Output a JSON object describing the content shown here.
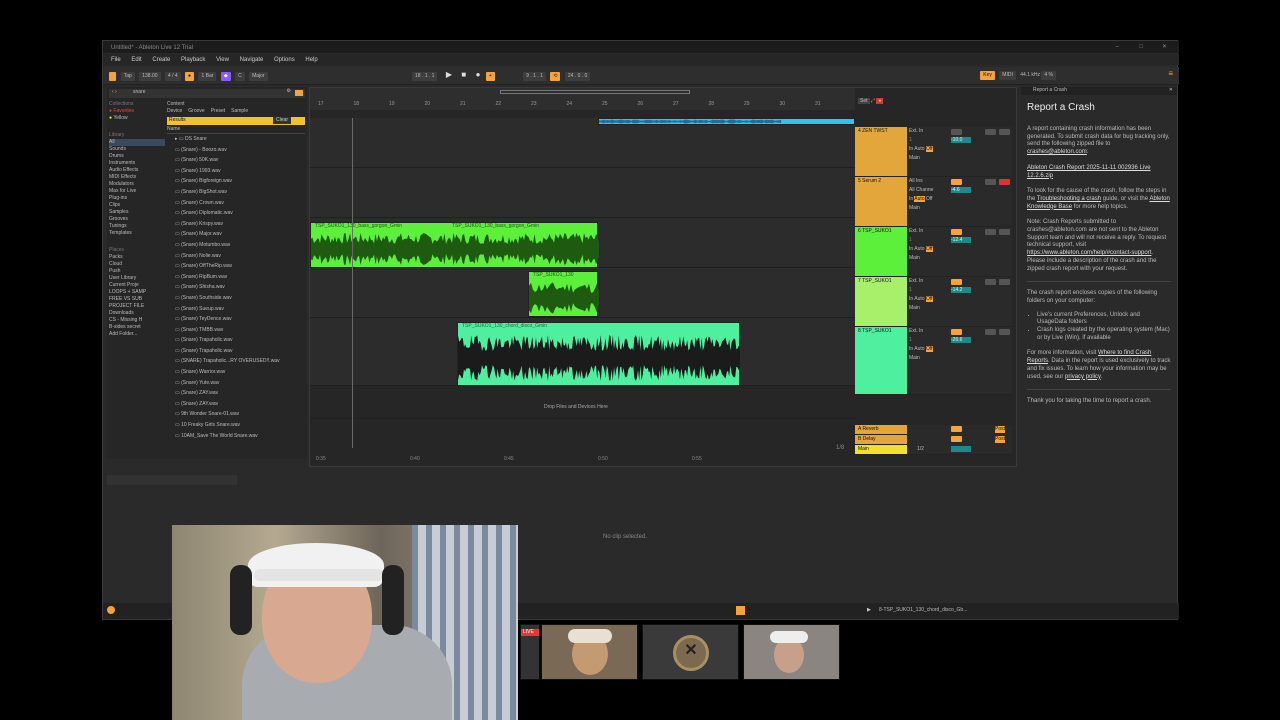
{
  "window": {
    "title": "Untitled* - Ableton Live 12 Trial"
  },
  "menu": [
    "File",
    "Edit",
    "Create",
    "Playback",
    "View",
    "Navigate",
    "Options",
    "Help"
  ],
  "control_bar": {
    "tap": "Tap",
    "tempo": "138.00",
    "time_sig": "4 / 4",
    "quant": "1 Bar",
    "key": "C",
    "scale": "Major",
    "position": "18 . 1 . 1",
    "loop_start": "9 . 1 . 1",
    "loop_len": "24 . 0 . 0",
    "key_label": "Key",
    "midi_label": "MIDI",
    "sample_rate": "44.1 kHz",
    "cpu": "4 %"
  },
  "browser": {
    "search": "snare",
    "collections_label": "Collections",
    "collections": [
      "Favorites",
      "Yellow"
    ],
    "library_label": "Library",
    "library": [
      "All",
      "Sounds",
      "Drums",
      "Instruments",
      "Audio Effects",
      "MIDI Effects",
      "Modulators",
      "Max for Live",
      "Plug-ins",
      "Clips",
      "Samples",
      "Grooves",
      "Tunings",
      "Templates"
    ],
    "places_label": "Places",
    "places": [
      "Packs",
      "Cloud",
      "Push",
      "User Library",
      "Current Proje",
      "LOOPS + SAMP",
      "FREE VS SUB",
      "PROJECT FILE",
      "Downloads",
      "CS - Missing H",
      "B-sides secret",
      "Add Folder..."
    ],
    "content_label": "Content",
    "filters": [
      "Device",
      "Groove",
      "Preset",
      "Sample"
    ],
    "results_label": "Results",
    "clear_label": "Clear",
    "name_header": "Name",
    "files": [
      "DS Snare",
      "(Snare) - Boozo.wav",
      "(Snare) 50K.wav",
      "(Snare) 1993.wav",
      "(Snare) Bigforeign.wav",
      "(Snare) BigShot.wav",
      "(Snare) Crown.wav",
      "(Snare) Diplomatic.wav",
      "(Snare) Krispy.wav",
      "(Snare) Major.wav",
      "(Snare) Motumbo.wav",
      "(Snare) Nolie.wav",
      "(Snare) OffTheRip.wav",
      "(Snare) RipBum.wav",
      "(Snare) Shisha.wav",
      "(Snare) Southside.wav",
      "(Snare) Sueup.wav",
      "(Snare) TeyDence.wav",
      "(Snare) TMBB.wav",
      "(Snare) Trapaholic.wav",
      "(Snare) Trapaholic.wav",
      "(SNARE) Trapaholic...RY OVERUSED!!.wav",
      "(Snare) Warrior.wav",
      "(Snare) Yute.wav",
      "(Snare) ZAY.wav",
      "(Snare) ZAY.wav",
      "9th Wonder Snare-01.wav",
      "10 Freaky Girls Snare.wav",
      "10AM_Save The World Snare.wav"
    ]
  },
  "arrangement": {
    "bar_numbers": [
      "17",
      "18",
      "19",
      "20",
      "21",
      "22",
      "23",
      "24",
      "25",
      "26",
      "27",
      "28",
      "29",
      "30",
      "31"
    ],
    "time_marks": [
      "0:35",
      "0:40",
      "0:45",
      "0:50",
      "0:55"
    ],
    "drop_text": "Drop Files and Devices Here",
    "clip_name_bass": "TSP_SUKO1_130_bass_gorgon_Gmin",
    "clip_name_bass2": "TSP_SUKO1_130_bass_gorgon_Gmin",
    "clip_name_short": "TSP_SUKO1_130",
    "clip_name_chord": "TSP_SUKO1_130_chord_disco_Gmin",
    "zoom_fraction": "1/8",
    "tracks": [
      {
        "name": "4 ZEN TWST",
        "color": "#e3a63a"
      },
      {
        "name": "5 Serum 2",
        "color": "#e3a63a"
      },
      {
        "name": "6 TSP_SUKO1",
        "color": "#5cf03a"
      },
      {
        "name": "7 TSP_SUKO1",
        "color": "#a8f06a"
      },
      {
        "name": "8 TSP_SUKO1",
        "color": "#4ef0a0"
      }
    ],
    "returns": [
      "A Reverb",
      "B Delay",
      "Main"
    ],
    "mixer": {
      "ext_in": "Ext. In",
      "all_ins": "All Ins",
      "all_channels": "All Channe",
      "in": "In",
      "auto": "Auto",
      "off": "Off",
      "main": "Main",
      "vol1": "-10.0",
      "vol2": "-4.6",
      "vol3": "-12.4",
      "vol4": "-14.2",
      "vol5": "-26.6",
      "post": "Post",
      "main_frac": "1/2"
    }
  },
  "detail": {
    "no_clip": "No clip selected."
  },
  "status": {
    "clip_path": "8-TSP_SUKO1_130_chord_disco_Gb..."
  },
  "crash_panel": {
    "header": "Report a Crash",
    "title": "Report a Crash",
    "p1": "A report containing crash information has been generated. To submit crash data for bug tracking only, send the following zipped file to",
    "email": "crashes@ableton.com",
    "zipfile": "Ableton Crash Report 2025-11-11 002936 Live 12.2.6.zip",
    "p2a": "To look for the cause of the crash, follow the steps in the",
    "p2_link": "Troubleshooting a crash",
    "p2b": "guide, or visit the",
    "p2_link2": "Ableton Knowledge Base",
    "p2c": "for more help topics.",
    "p3": "Note: Crash Reports submitted to crashes@ableton.com are not sent to the Ableton Support team and will not receive a reply. To request technical support, visit",
    "support_link": "https://www.ableton.com/help/#contact-support",
    "p3b": ". Please include a description of the crash and the zipped crash report with your request.",
    "p4": "The crash report encloses copies of the following folders on your computer:",
    "b1": "Live's current Preferences, Unlock and UsageData folders",
    "b2": "Crash logs created by the operating system (Mac) or by Live (Win), if available",
    "p5a": "For more information, visit",
    "p5_link": "Where to find Crash Reports",
    "p5b": ". Data in the report is used exclusively to track and fix issues. To learn how your information may be used, see our",
    "p5_link2": "privacy policy",
    "p6": "Thank you for taking the time to report a crash."
  },
  "overlay": {
    "live_badge": "LIVE"
  }
}
